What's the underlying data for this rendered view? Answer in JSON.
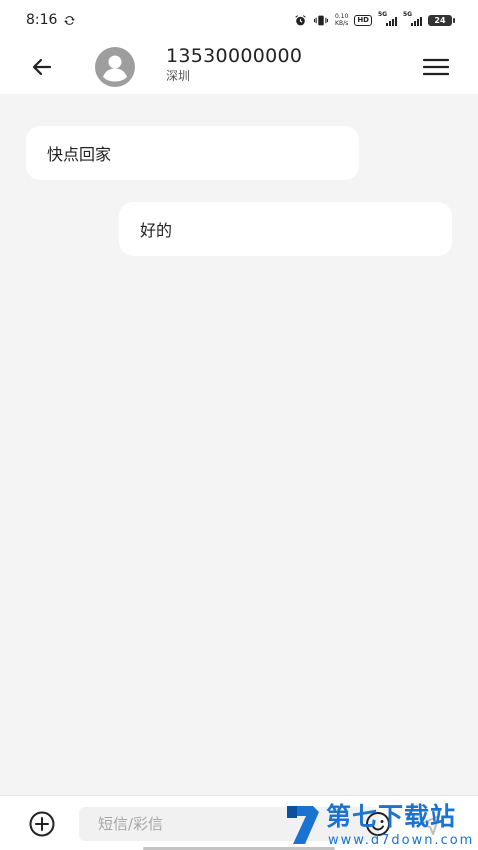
{
  "status_bar": {
    "time": "8:16",
    "net_speed_value": "0.10",
    "net_speed_unit": "KB/s",
    "hd_label": "HD",
    "sim1_label": "5G",
    "sim2_label": "5G",
    "battery_level": "24",
    "icons": [
      "sync-icon",
      "alarm-icon",
      "vibrate-icon"
    ]
  },
  "header": {
    "contact_number": "13530000000",
    "contact_location": "深圳",
    "icons": [
      "back-arrow-icon",
      "avatar-person-icon",
      "menu-icon"
    ]
  },
  "messages": [
    {
      "direction": "incoming",
      "text": "快点回家"
    },
    {
      "direction": "outgoing",
      "text": "好的"
    }
  ],
  "composer": {
    "placeholder": "短信/彩信",
    "value": "",
    "icons": [
      "add-circle-icon",
      "emoji-icon",
      "send-icon"
    ]
  },
  "watermark": {
    "title": "第七下载站",
    "url": "www.d7down.com",
    "brand_color": "#1a73d0"
  }
}
